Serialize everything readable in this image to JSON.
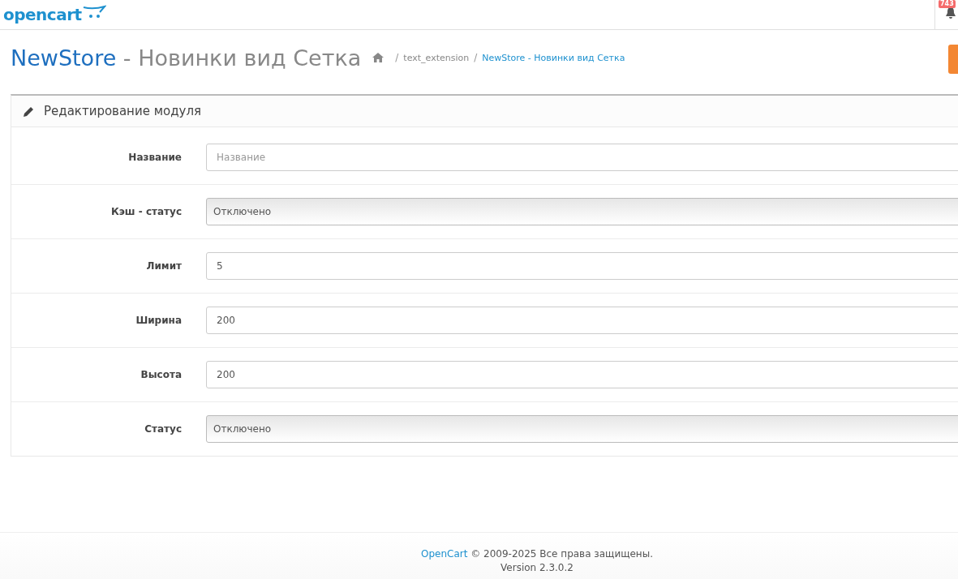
{
  "header": {
    "logo": "opencart",
    "notification_count": "743"
  },
  "page_title": {
    "store": "NewStore",
    "rest": " - Новинки вид Сетка"
  },
  "breadcrumbs": [
    {
      "separator": "/",
      "label": "text_extension",
      "current": false
    },
    {
      "separator": "/",
      "label": "NewStore - Новинки вид Сетка",
      "current": true
    }
  ],
  "panel": {
    "title": "Редактирование модуля"
  },
  "fields": [
    {
      "kind": "text",
      "label": "Название",
      "placeholder": "Название"
    },
    {
      "kind": "select",
      "label": "Кэш - статус",
      "value": "Отключено"
    },
    {
      "kind": "text",
      "label": "Лимит",
      "value": "5"
    },
    {
      "kind": "text",
      "label": "Ширина",
      "value": "200"
    },
    {
      "kind": "text",
      "label": "Высота",
      "value": "200"
    },
    {
      "kind": "select",
      "label": "Статус",
      "value": "Отключено"
    }
  ],
  "footer": {
    "link": "OpenCart",
    "text": "© 2009-2025 Все права защищены.",
    "version": "Version 2.3.0.2"
  }
}
